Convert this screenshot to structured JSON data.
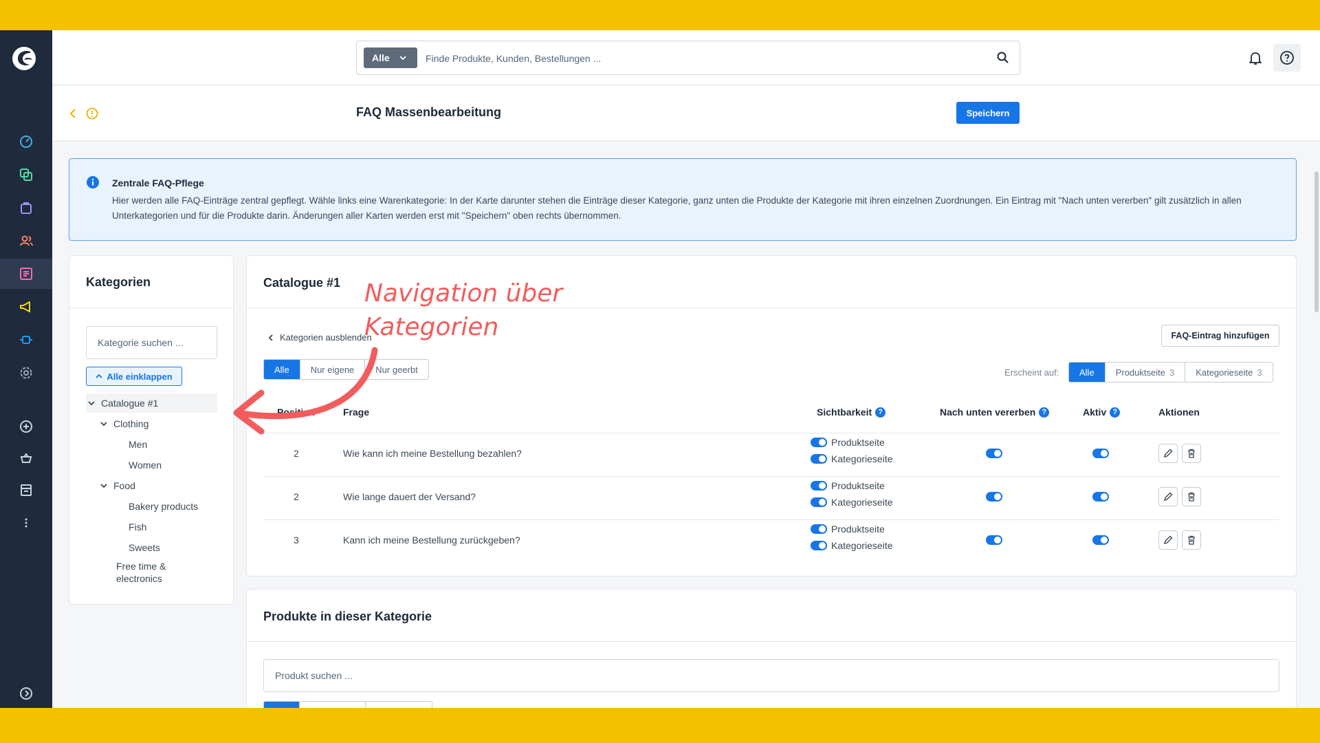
{
  "app": {
    "search": {
      "type_label": "Alle",
      "placeholder": "Finde Produkte, Kunden, Bestellungen ..."
    }
  },
  "page": {
    "title": "FAQ Massenbearbeitung",
    "save_label": "Speichern"
  },
  "alert": {
    "title": "Zentrale FAQ-Pflege",
    "text": "Hier werden alle FAQ-Einträge zentral gepflegt. Wähle links eine Warenkategorie: In der Karte darunter stehen die Einträge dieser Kategorie, ganz unten die Produkte der Kategorie mit ihren einzelnen Zuordnungen. Ein Eintrag mit \"Nach unten vererben\" gilt zusätzlich in allen Unterkategorien und für die Produkte darin. Änderungen aller Karten werden erst mit \"Speichern\" oben rechts übernommen."
  },
  "categories": {
    "title": "Kategorien",
    "search_placeholder": "Kategorie suchen ...",
    "collapse_label": "Alle einklappen",
    "tree": [
      {
        "label": "Catalogue #1",
        "level": 0,
        "expanded": true,
        "selected": true
      },
      {
        "label": "Clothing",
        "level": 1,
        "expanded": true
      },
      {
        "label": "Men",
        "level": 2
      },
      {
        "label": "Women",
        "level": 2
      },
      {
        "label": "Food",
        "level": 1,
        "expanded": true
      },
      {
        "label": "Bakery products",
        "level": 2
      },
      {
        "label": "Fish",
        "level": 2
      },
      {
        "label": "Sweets",
        "level": 2
      },
      {
        "label": "Free time & electronics",
        "level": 1
      }
    ]
  },
  "faq": {
    "title": "Catalogue #1",
    "hide_categories_label": "Kategorien ausblenden",
    "add_label": "FAQ-Eintrag hinzufügen",
    "filter": [
      "Alle",
      "Nur eigene",
      "Nur geerbt"
    ],
    "filter_active": "Alle",
    "appears_label": "Erscheint auf:",
    "appears": [
      {
        "label": "Alle",
        "count": null
      },
      {
        "label": "Produktseite",
        "count": "3"
      },
      {
        "label": "Kategorieseite",
        "count": "3"
      }
    ],
    "columns": {
      "position": "Position",
      "question": "Frage",
      "visibility": "Sichtbarkeit",
      "inherit": "Nach unten vererben",
      "active": "Aktiv",
      "actions": "Aktionen"
    },
    "rows": [
      {
        "position": "2",
        "question": "Wie kann ich meine Bestellung bezahlen?",
        "vis_product": "Produktseite",
        "vis_category": "Kategorieseite",
        "inherit": true,
        "active": true
      },
      {
        "position": "2",
        "question": "Wie lange dauert der Versand?",
        "vis_product": "Produktseite",
        "vis_category": "Kategorieseite",
        "inherit": true,
        "active": true
      },
      {
        "position": "3",
        "question": "Kann ich meine Bestellung zurückgeben?",
        "vis_product": "Produktseite",
        "vis_category": "Kategorieseite",
        "inherit": true,
        "active": true
      }
    ]
  },
  "products": {
    "title": "Produkte in dieser Kategorie",
    "search_placeholder": "Produkt suchen ..."
  },
  "annotation": {
    "line1": "Navigation über",
    "line2": "Kategorien"
  },
  "colors": {
    "accent": "#1776e5",
    "sidebar": "#1f2a3d",
    "frame_band": "#f4c000",
    "annotation": "#f25c5c"
  },
  "icons": {
    "sidebar": [
      "dashboard-icon",
      "catalogue-icon",
      "orders-icon",
      "customers-icon",
      "content-icon",
      "marketing-icon",
      "extensions-icon",
      "settings-icon",
      "add-sales-channel-icon",
      "sales-channel-basket-icon",
      "sales-channel-store-icon",
      "more-icon",
      "expand-sidebar-icon"
    ]
  }
}
